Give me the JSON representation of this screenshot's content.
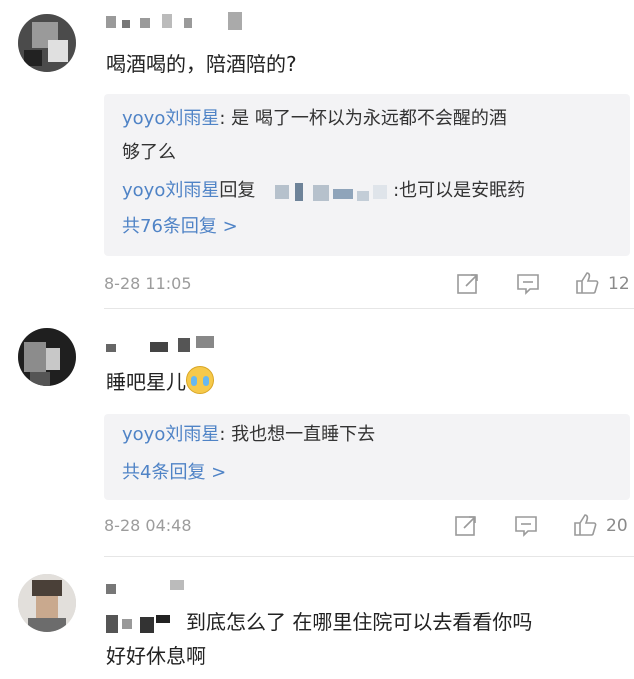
{
  "comments": [
    {
      "text": "喝酒喝的，陪酒陪的?",
      "replies": [
        {
          "name": "yoyo刘雨星",
          "sep": ": ",
          "body": "是 喝了一杯以为永远都不会醒的酒",
          "cont": "够了么"
        },
        {
          "name": "yoyo刘雨星",
          "mid": "回复",
          "tail": ":也可以是安眠药"
        }
      ],
      "more": "共76条回复 >",
      "time": "8-28 11:05",
      "likes": "12"
    },
    {
      "text": "睡吧星儿",
      "emoji": "crying-emoji",
      "replies": [
        {
          "name": "yoyo刘雨星",
          "sep": ": ",
          "body": "我也想一直睡下去"
        }
      ],
      "more": "共4条回复 >",
      "time": "8-28 04:48",
      "likes": "20"
    },
    {
      "text": "到底怎么了 在哪里住院可以去看看你吗",
      "cont": "好好休息啊"
    }
  ],
  "icons": {
    "share": "share-icon",
    "comment": "comment-icon",
    "like": "thumbs-up-icon"
  }
}
